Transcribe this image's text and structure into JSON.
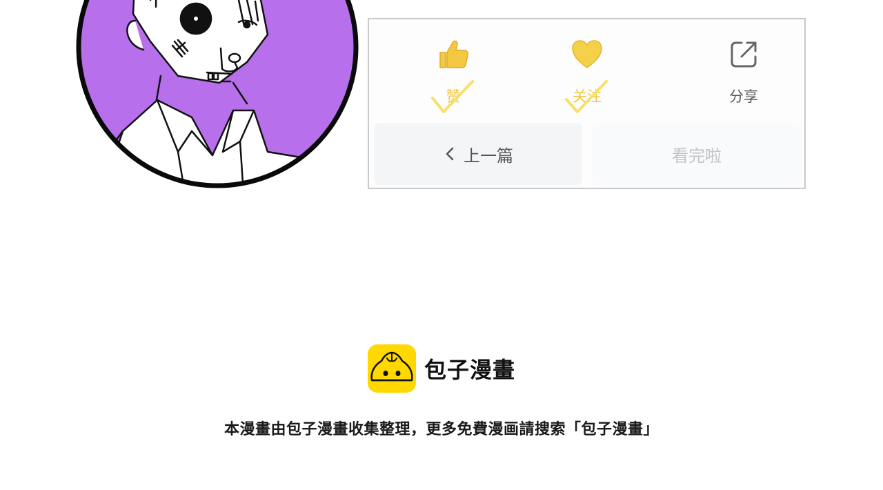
{
  "actions": {
    "like_label": "赞",
    "follow_label": "关注",
    "share_label": "分享"
  },
  "navigation": {
    "prev_label": "上一篇",
    "finish_label": "看完啦"
  },
  "brand": {
    "name": "包子漫畫",
    "logo_color": "#ffd800"
  },
  "footer": {
    "note": "本漫畫由包子漫畫收集整理，更多免費漫画請搜索「包子漫畫」"
  },
  "colors": {
    "accent_yellow": "#f1c540",
    "avatar_bg": "#b76fec"
  },
  "icons": {
    "like": "thumbs-up-icon",
    "follow": "heart-icon",
    "share": "share-icon",
    "prev": "chevron-left-icon"
  }
}
